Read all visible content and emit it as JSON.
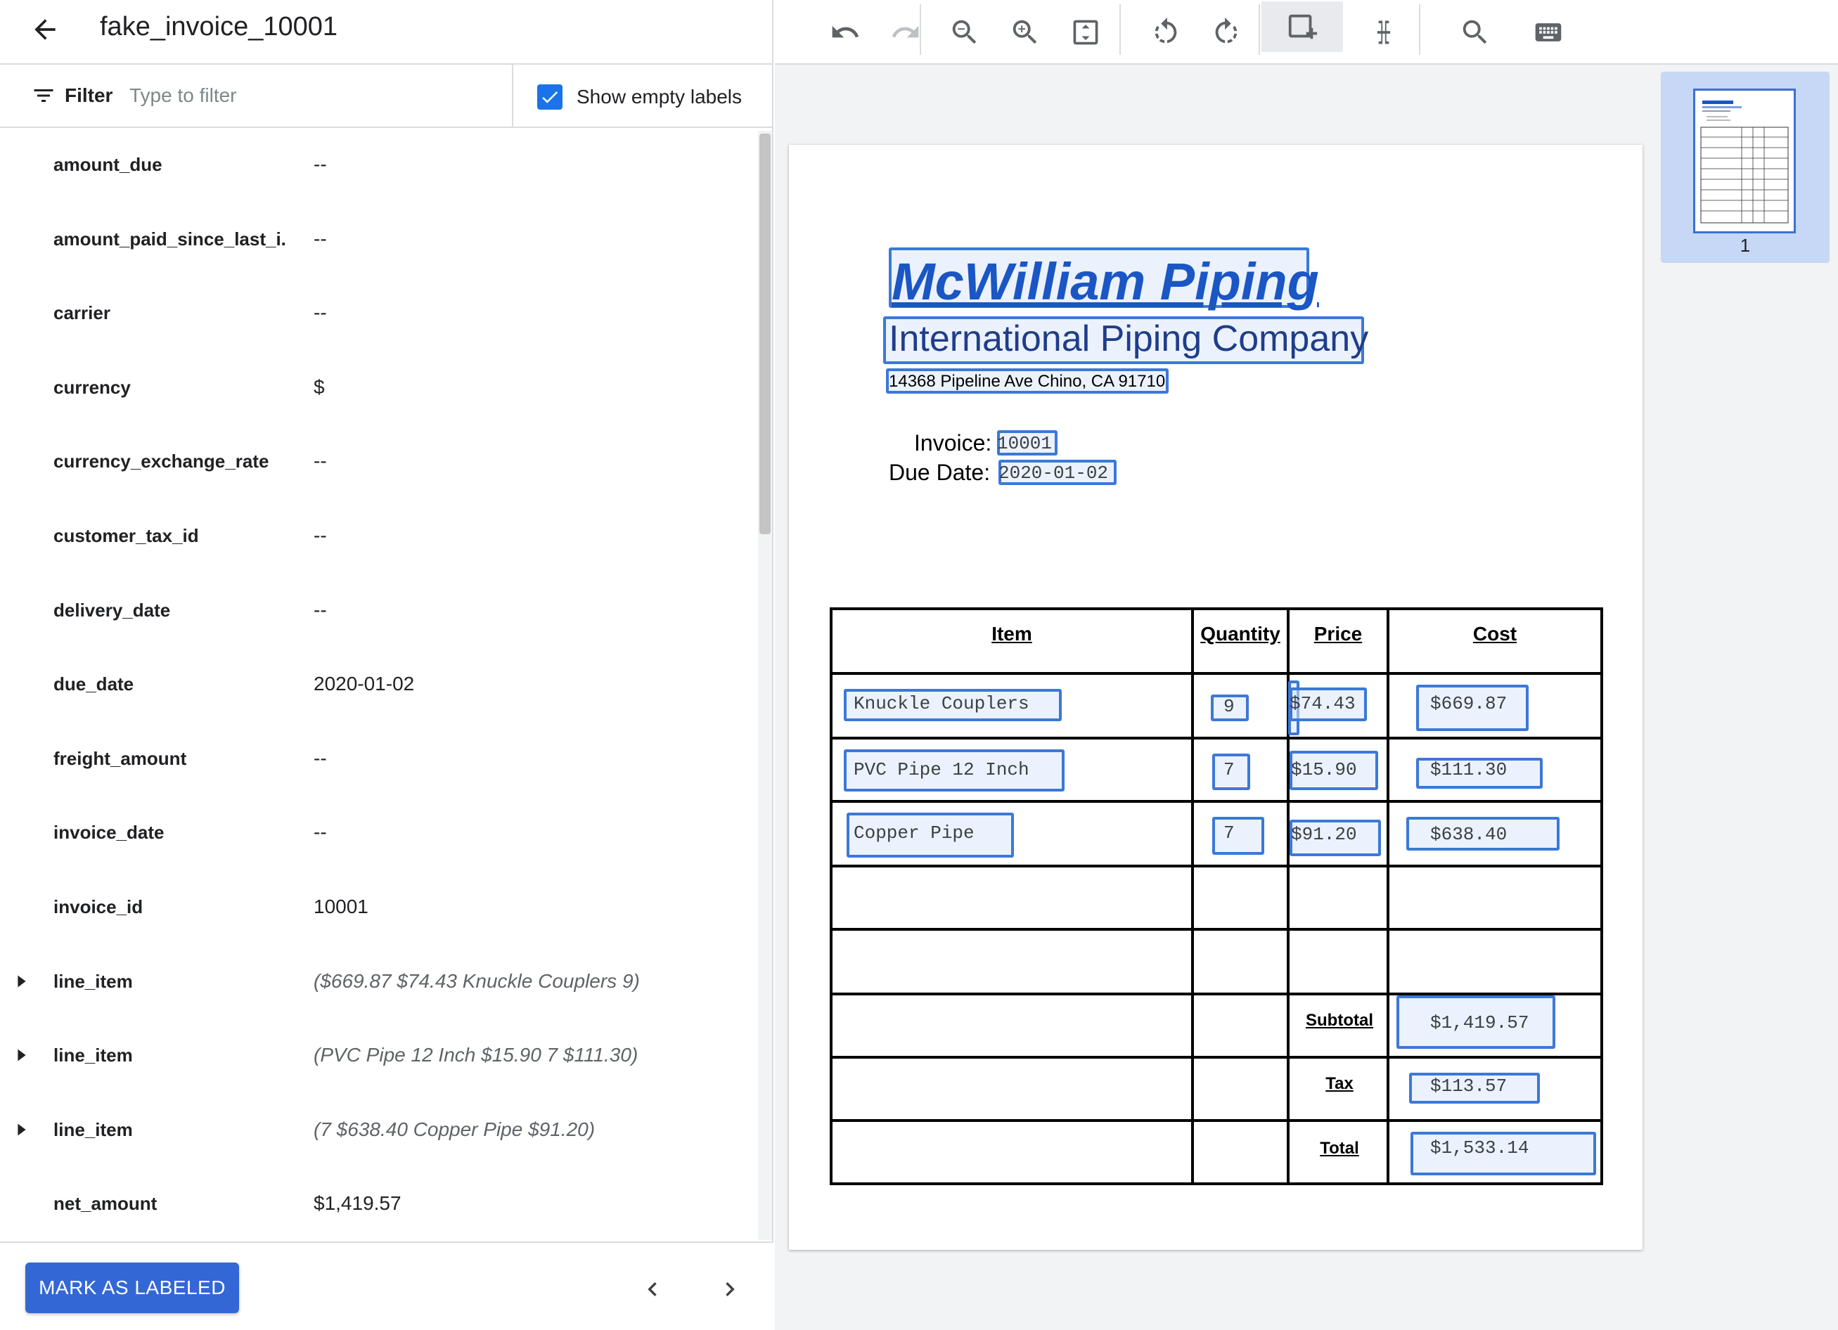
{
  "header": {
    "title": "fake_invoice_10001"
  },
  "filter": {
    "label": "Filter",
    "placeholder": "Type to filter",
    "show_empty_label": "Show empty labels",
    "show_empty_checked": true
  },
  "fields": [
    {
      "name": "amount_due",
      "value": "--",
      "expandable": false
    },
    {
      "name": "amount_paid_since_last_i...",
      "value": "--",
      "expandable": false
    },
    {
      "name": "carrier",
      "value": "--",
      "expandable": false
    },
    {
      "name": "currency",
      "value": "$",
      "expandable": false
    },
    {
      "name": "currency_exchange_rate",
      "value": "--",
      "expandable": false
    },
    {
      "name": "customer_tax_id",
      "value": "--",
      "expandable": false
    },
    {
      "name": "delivery_date",
      "value": "--",
      "expandable": false
    },
    {
      "name": "due_date",
      "value": "2020-01-02",
      "expandable": false
    },
    {
      "name": "freight_amount",
      "value": "--",
      "expandable": false
    },
    {
      "name": "invoice_date",
      "value": "--",
      "expandable": false
    },
    {
      "name": "invoice_id",
      "value": "10001",
      "expandable": false
    },
    {
      "name": "line_item",
      "value": "($669.87 $74.43 Knuckle Couplers 9)",
      "expandable": true
    },
    {
      "name": "line_item",
      "value": "(PVC Pipe 12 Inch $15.90 7 $111.30)",
      "expandable": true
    },
    {
      "name": "line_item",
      "value": "(7 $638.40 Copper Pipe $91.20)",
      "expandable": true
    },
    {
      "name": "net_amount",
      "value": "$1,419.57",
      "expandable": false
    }
  ],
  "footer": {
    "mark_button": "MARK AS LABELED"
  },
  "toolbar": {
    "tools": [
      "undo-icon",
      "redo-icon",
      "zoom-out-icon",
      "zoom-in-icon",
      "fit-page-icon",
      "rotate-left-icon",
      "rotate-right-icon",
      "add-box-icon",
      "text-cursor-icon",
      "search-icon",
      "keyboard-icon"
    ],
    "active_tool": "add-box-icon"
  },
  "thumbnail": {
    "page_number": "1"
  },
  "invoice": {
    "company": "McWilliam Piping",
    "tagline": "International Piping Company",
    "address": "14368 Pipeline Ave Chino, CA 91710",
    "invoice_label": "Invoice:",
    "invoice_number": "10001",
    "due_label": "Due Date:",
    "due_date": "2020-01-02",
    "headers": {
      "item": "Item",
      "quantity": "Quantity",
      "price": "Price",
      "cost": "Cost"
    },
    "rows": [
      {
        "item": "Knuckle Couplers",
        "quantity": "9",
        "price": "$74.43",
        "cost": "$669.87"
      },
      {
        "item": "PVC Pipe 12 Inch",
        "quantity": "7",
        "price": "$15.90",
        "cost": "$111.30"
      },
      {
        "item": "Copper Pipe",
        "quantity": "7",
        "price": "$91.20",
        "cost": "$638.40"
      }
    ],
    "subtotal_label": "Subtotal",
    "subtotal": "$1,419.57",
    "tax_label": "Tax",
    "tax": "$113.57",
    "total_label": "Total",
    "total": "$1,533.14"
  },
  "colors": {
    "accent": "#1a73e8",
    "button": "#3367d6",
    "box_border": "#3c78d8",
    "company": "#1a56c4"
  }
}
